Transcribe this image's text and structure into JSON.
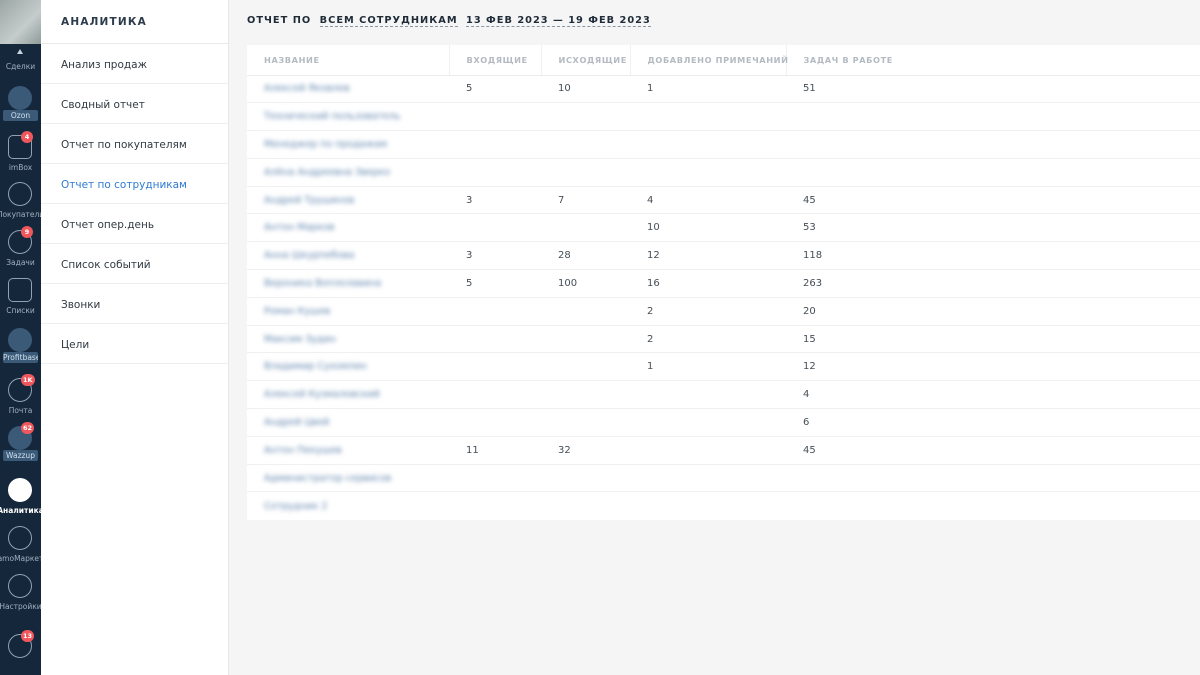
{
  "left_nav": {
    "items": [
      {
        "name": "deals",
        "label": "Сделки",
        "icon": "up-arrow-icon"
      },
      {
        "name": "ozon",
        "label": "Ozon",
        "icon": "ozon-icon",
        "boxed": true
      },
      {
        "name": "imbox",
        "label": "imBox",
        "icon": "chat-bubble-icon",
        "badge": "4"
      },
      {
        "name": "customers",
        "label": "Покупатели",
        "icon": "user-icon"
      },
      {
        "name": "tasks",
        "label": "Задачи",
        "icon": "check-circle-icon",
        "badge": "9"
      },
      {
        "name": "lists",
        "label": "Списки",
        "icon": "list-icon"
      },
      {
        "name": "profitbase",
        "label": "Profitbase",
        "icon": "pb-icon",
        "boxed": true
      },
      {
        "name": "mail",
        "label": "Почта",
        "icon": "envelope-icon",
        "badge": "1K"
      },
      {
        "name": "wazzup",
        "label": "Wazzup",
        "icon": "wazzup-icon",
        "badge": "62",
        "boxed": true
      },
      {
        "name": "analytics",
        "label": "Аналитика",
        "icon": "chart-icon",
        "active": true
      },
      {
        "name": "amomarket",
        "label": "amoМаркет",
        "icon": "market-icon"
      },
      {
        "name": "settings",
        "label": "Настройки",
        "icon": "wrench-icon"
      },
      {
        "name": "notifications",
        "label": "",
        "icon": "bell-icon",
        "badge": "13"
      }
    ]
  },
  "submenu": {
    "title": "АНАЛИТИКА",
    "items": [
      {
        "label": "Анализ продаж"
      },
      {
        "label": "Сводный отчет"
      },
      {
        "label": "Отчет по покупателям"
      },
      {
        "label": "Отчет по сотрудникам",
        "active": true
      },
      {
        "label": "Отчет опер.день"
      },
      {
        "label": "Список событий"
      },
      {
        "label": "Звонки"
      },
      {
        "label": "Цели"
      }
    ]
  },
  "report": {
    "prefix": "ОТЧЕТ ПО",
    "scope": "ВСЕМ СОТРУДНИКАМ",
    "period": "13 ФЕВ 2023 — 19 ФЕВ 2023"
  },
  "table": {
    "columns": [
      "НАЗВАНИЕ",
      "ВХОДЯЩИЕ",
      "ИСХОДЯЩИЕ",
      "ДОБАВЛЕНО ПРИМЕЧАНИЙ",
      "ЗАДАЧ В РАБОТЕ"
    ],
    "rows": [
      [
        "Алексей Яковлев",
        "5",
        "10",
        "1",
        "51"
      ],
      [
        "Технический пользователь",
        "",
        "",
        "",
        ""
      ],
      [
        "Менеджер по продажам",
        "",
        "",
        "",
        ""
      ],
      [
        "Алёна Андреевна Зверко",
        "",
        "",
        "",
        ""
      ],
      [
        "Андрей Трушинов",
        "3",
        "7",
        "4",
        "45"
      ],
      [
        "Антон Марков",
        "",
        "",
        "10",
        "53"
      ],
      [
        "Анна Шкурпебова",
        "3",
        "28",
        "12",
        "118"
      ],
      [
        "Вероника Воплолавина",
        "5",
        "100",
        "16",
        "263"
      ],
      [
        "Роман Кушев",
        "",
        "",
        "2",
        "20"
      ],
      [
        "Максим Зудин",
        "",
        "",
        "2",
        "15"
      ],
      [
        "Владимир Сухомлин",
        "",
        "",
        "1",
        "12"
      ],
      [
        "Алексей Кузмаловский",
        "",
        "",
        "",
        "4"
      ],
      [
        "Андрей Цвей",
        "",
        "",
        "",
        "6"
      ],
      [
        "Антон Пекушев",
        "11",
        "32",
        "",
        "45"
      ],
      [
        "Администратор сервисов",
        "",
        "",
        "",
        ""
      ],
      [
        "Сотрудник 2",
        "",
        "",
        "",
        ""
      ]
    ]
  }
}
